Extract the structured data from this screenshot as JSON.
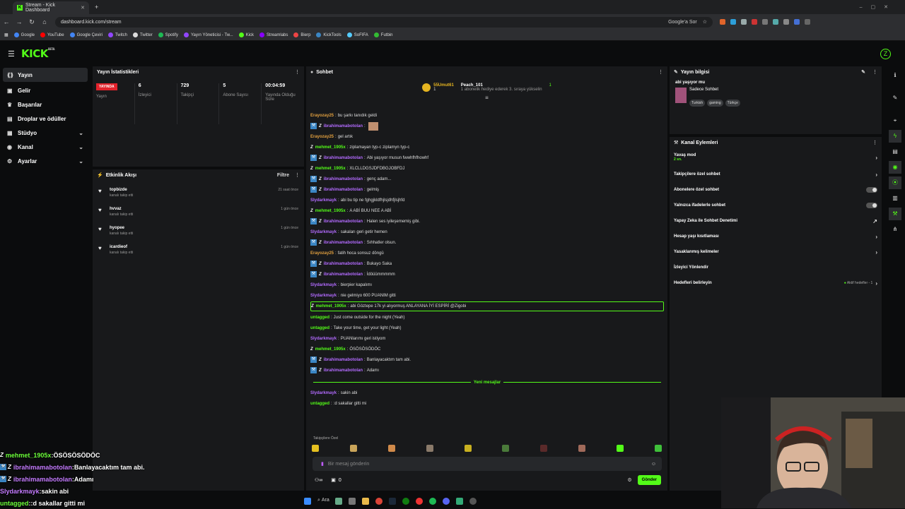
{
  "browser": {
    "tab_title": "Stream - Kick Dashboard",
    "url": "dashboard.kick.com/stream",
    "google_ask": "Google'a Sor",
    "bookmarks": [
      "Google",
      "YouTube",
      "Google Çeviri",
      "Twitch",
      "Twitter",
      "Spotify",
      "Yayın Yöneticisi - Tw...",
      "Kick",
      "Streamlabs",
      "Bierp",
      "KickTools",
      "SoFIFA",
      "Futbin"
    ]
  },
  "header": {
    "logo": "KICK",
    "logo_badge": "BETA",
    "avatar": "Z"
  },
  "sidebar": {
    "items": [
      {
        "label": "Yayın",
        "icon": "broadcast-icon"
      },
      {
        "label": "Gelir",
        "icon": "wallet-icon"
      },
      {
        "label": "Başarılar",
        "icon": "trophy-icon"
      },
      {
        "label": "Droplar ve ödüller",
        "icon": "gift-icon"
      },
      {
        "label": "Stüdyo",
        "icon": "grid-icon"
      },
      {
        "label": "Kanal",
        "icon": "user-icon"
      },
      {
        "label": "Ayarlar",
        "icon": "gear-icon"
      }
    ]
  },
  "stats": {
    "title": "Yayın İstatistikleri",
    "live_badge": "YAYINDA",
    "cols": [
      {
        "value": "",
        "label": "Yayın"
      },
      {
        "value": "6",
        "label": "İzleyici"
      },
      {
        "value": "729",
        "label": "Takipçi"
      },
      {
        "value": "5",
        "label": "Abone Sayısı"
      },
      {
        "value": "00:04:59",
        "label": "Yayında Olduğu Süre"
      }
    ]
  },
  "activity": {
    "title": "Etkinlik Akışı",
    "filter": "Filtre",
    "items": [
      {
        "name": "topbizde",
        "sub": "kanalı takip etti",
        "time": "21 saat önce"
      },
      {
        "name": "hvvaz",
        "sub": "kanalı takip etti",
        "time": "1 gün önce"
      },
      {
        "name": "hyopee",
        "sub": "kanalı takip etti",
        "time": "1 gün önce"
      },
      {
        "name": "icardieof",
        "sub": "kanalı takip etti",
        "time": "1 gün önce"
      }
    ]
  },
  "chat": {
    "title": "Sohbet",
    "top_user1": "55Umut61",
    "top_user1_count": "1",
    "top_user2": "Peach_101",
    "top_user2_count": "1",
    "hype_text": "1 abonelik hediye ederek 3. sıraya yükselin",
    "messages": [
      {
        "user": "Erayozay25",
        "color": "#e2a03f",
        "text": "bu şarkı tanıdık geldi",
        "badge": ""
      },
      {
        "user": "ibrahimamabotolan",
        "color": "#b36bff",
        "text": "",
        "badge": "both"
      },
      {
        "user": "Erayozay25",
        "color": "#e2a03f",
        "text": "gel artık",
        "badge": ""
      },
      {
        "user": "mehmet_1905x",
        "color": "#53fc18",
        "text": "ziplamayan typ-c ziplamyn typ-c",
        "badge": "z"
      },
      {
        "user": "ibrahimamabotolan",
        "color": "#b36bff",
        "text": "Abi yaşıyor musun fwwhfhfhowhf",
        "badge": "both"
      },
      {
        "user": "mehmet_1905x",
        "color": "#53fc18",
        "text": "XLCLLDGSJDFDBGJOBFDJ",
        "badge": "z"
      },
      {
        "user": "ibrahimamabotolan",
        "color": "#b36bff",
        "text": "genç adam...",
        "badge": "both"
      },
      {
        "user": "ibrahimamabotolan",
        "color": "#b36bff",
        "text": "gelmiş",
        "badge": "both"
      },
      {
        "user": "Slydarkmayk",
        "color": "#b36bff",
        "text": "abi bu tip ne fghgjkldfhjlsjdhfjlsjhfd",
        "badge": ""
      },
      {
        "user": "mehmet_1905x",
        "color": "#53fc18",
        "text": "A ABİ BUU NEE A ABİ",
        "badge": "z"
      },
      {
        "user": "ibrahimamabotolan",
        "color": "#b36bff",
        "text": "Halen ses iyileşememiş gibi.",
        "badge": "both"
      },
      {
        "user": "Slydarkmayk",
        "color": "#b36bff",
        "text": "sakaları geri getir hemen",
        "badge": ""
      },
      {
        "user": "ibrahimamabotolan",
        "color": "#b36bff",
        "text": "Sıhhatler olsun.",
        "badge": "both"
      },
      {
        "user": "Erayozay25",
        "color": "#e2a03f",
        "text": "fatih hoca sonsuz döngü",
        "badge": ""
      },
      {
        "user": "ibrahimamabotolan",
        "color": "#b36bff",
        "text": "Bukayo Saka",
        "badge": "both"
      },
      {
        "user": "ibrahimamabotolan",
        "color": "#b36bff",
        "text": "İdöüümmmmm",
        "badge": "both"
      },
      {
        "user": "Slydarkmayk",
        "color": "#b36bff",
        "text": "bierpier kapalımı",
        "badge": ""
      },
      {
        "user": "Slydarkmayk",
        "color": "#b36bff",
        "text": "nie gelmiyo 600 PUANIM gitti",
        "badge": ""
      },
      {
        "user": "mehmet_1905x",
        "color": "#53fc18",
        "text": "abi Göztepe 17k yi alıyormuş ANLAYANA İYİ ESPİRİ @Zigobi",
        "badge": "z",
        "highlight": true
      },
      {
        "user": "untagged",
        "color": "#53fc18",
        "text": "Just come outside for the night (Yeah)",
        "badge": ""
      },
      {
        "user": "untagged",
        "color": "#53fc18",
        "text": "Take your time, get your light (Yeah)",
        "badge": ""
      },
      {
        "user": "Slydarkmayk",
        "color": "#b36bff",
        "text": "PUANlarımı geri istiyom",
        "badge": ""
      },
      {
        "user": "mehmet_1905x",
        "color": "#53fc18",
        "text": "ÖSÖSÖSÖDÖC",
        "badge": "z"
      },
      {
        "user": "ibrahimamabotolan",
        "color": "#b36bff",
        "text": "Banlayacaktım tam abi.",
        "badge": "both"
      },
      {
        "user": "ibrahimamabotolan",
        "color": "#b36bff",
        "text": "Adamı",
        "badge": "both"
      }
    ],
    "new_label": "Yeni mesajlar",
    "new_messages": [
      {
        "user": "Slydarkmayk",
        "color": "#b36bff",
        "text": "sakin abi"
      },
      {
        "user": "untagged",
        "color": "#53fc18",
        "text": ":d sakallar gitti mi"
      }
    ],
    "followers_only": "Takipçilere Özel",
    "placeholder": "Bir mesaj gönderin",
    "points": "0",
    "send": "Gönder"
  },
  "info": {
    "title": "Yayın bilgisi",
    "stream_title": "abi yaşıyor mu",
    "category": "Sadece Sohbet",
    "tags": [
      "Turkish",
      "gaming",
      "Türkçe"
    ]
  },
  "actions": {
    "title": "Kanal Eylemleri",
    "slow_mode": "Yavaş mod",
    "slow_value": "2 sn.",
    "rows": [
      {
        "label": "Takipçilere özel sohbet",
        "ctl": "chev"
      },
      {
        "label": "Abonelere özel sohbet",
        "ctl": "toggle"
      },
      {
        "label": "Yalnızca ifadelerle sohbet",
        "ctl": "toggle"
      },
      {
        "label": "Yapay Zeka ile Sohbet Denetimi",
        "ctl": "ext"
      },
      {
        "label": "Hesap yaşı kısıtlaması",
        "ctl": "chev"
      },
      {
        "label": "Yasaklanmış kelimeler",
        "ctl": "chev"
      },
      {
        "label": "İzleyici Yönlendir",
        "ctl": ""
      }
    ],
    "goals": "Hedefleri belirleyin",
    "goals_status": "Aktif hedefler - 1"
  },
  "overlay": [
    {
      "badge": "z",
      "user": "mehmet_1905x",
      "color": "#6cff3a",
      "text": "ÖSÖSÖSÖDÖC"
    },
    {
      "badge": "both",
      "user": "ibrahimamabotolan",
      "color": "#c47bff",
      "text": "Banlayacaktım tam abi."
    },
    {
      "badge": "both",
      "user": "ibrahimamabotolan",
      "color": "#c47bff",
      "text": "Adamı"
    },
    {
      "badge": "",
      "user": "Slydarkmayk",
      "color": "#c47bff",
      "text": "sakin abi"
    },
    {
      "badge": "",
      "user": "untagged",
      "color": "#6cff3a",
      "text": ":d sakallar gitti mi"
    }
  ],
  "taskbar": {
    "search": "Ara"
  }
}
